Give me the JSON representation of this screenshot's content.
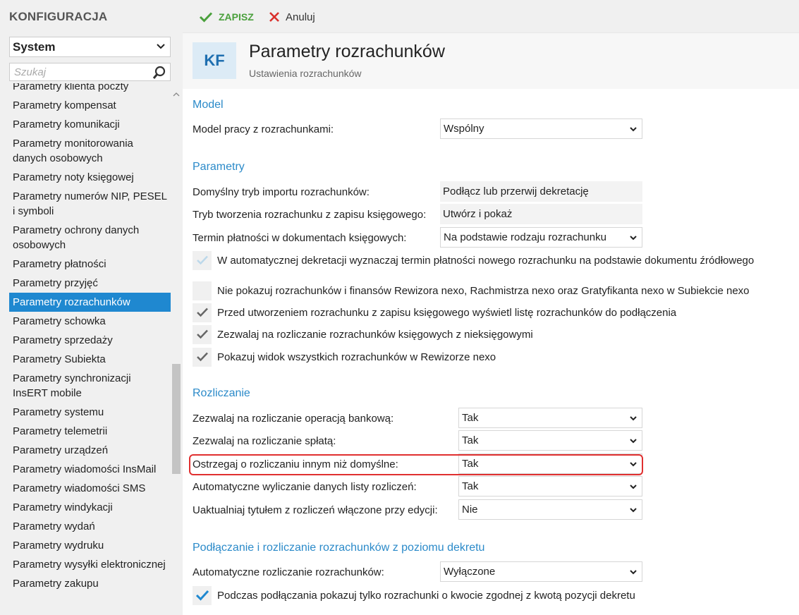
{
  "app": {
    "title": "KONFIGURACJA"
  },
  "toolbar": {
    "save_label": "ZAPISZ",
    "cancel_label": "Anuluj"
  },
  "sidebar": {
    "module": "System",
    "search_placeholder": "Szukaj",
    "items": [
      "Parametry klienta poczty",
      "Parametry kompensat",
      "Parametry komunikacji",
      "Parametry monitorowania danych osobowych",
      "Parametry noty księgowej",
      "Parametry numerów NIP, PESEL i symboli",
      "Parametry ochrony danych osobowych",
      "Parametry płatności",
      "Parametry przyjęć",
      "Parametry rozrachunków",
      "Parametry schowka",
      "Parametry sprzedaży",
      "Parametry Subiekta",
      "Parametry synchronizacji InsERT mobile",
      "Parametry systemu",
      "Parametry telemetrii",
      "Parametry urządzeń",
      "Parametry wiadomości InsMail",
      "Parametry wiadomości SMS",
      "Parametry windykacji",
      "Parametry wydań",
      "Parametry wydruku",
      "Parametry wysyłki elektronicznej",
      "Parametry zakupu"
    ],
    "active_index": 9
  },
  "header": {
    "badge": "KF",
    "title": "Parametry rozrachunków",
    "subtitle": "Ustawienia rozrachunków"
  },
  "model": {
    "section": "Model",
    "label": "Model pracy z rozrachunkami:",
    "value": "Wspólny"
  },
  "parametry": {
    "section": "Parametry",
    "import_label": "Domyślny tryb importu rozrachunków:",
    "import_value": "Podłącz lub przerwij dekretację",
    "create_label": "Tryb tworzenia rozrachunku z zapisu księgowego:",
    "create_value": "Utwórz i pokaż",
    "term_label": "Termin płatności w dokumentach księgowych:",
    "term_value": "Na podstawie rodzaju rozrachunku",
    "checkboxes": [
      {
        "label": "W automatycznej dekretacji wyznaczaj termin płatności nowego rozrachunku na podstawie dokumentu źródłowego",
        "state": "disabled-checked"
      },
      {
        "label": "Nie pokazuj rozrachunków i finansów Rewizora nexo, Rachmistrza nexo oraz Gratyfikanta nexo w Subiekcie nexo",
        "state": "unchecked"
      },
      {
        "label": "Przed utworzeniem rozrachunku z zapisu księgowego wyświetl listę rozrachunków do podłączenia",
        "state": "checked-grey"
      },
      {
        "label": "Zezwalaj na rozliczanie rozrachunków księgowych z nieksięgowymi",
        "state": "checked-grey"
      },
      {
        "label": "Pokazuj widok wszystkich rozrachunków w Rewizorze nexo",
        "state": "checked-grey"
      }
    ]
  },
  "rozliczanie": {
    "section": "Rozliczanie",
    "rows": [
      {
        "label": "Zezwalaj na rozliczanie operacją bankową:",
        "value": "Tak"
      },
      {
        "label": "Zezwalaj na rozliczanie spłatą:",
        "value": "Tak"
      },
      {
        "label": "Ostrzegaj o rozliczaniu innym niż domyślne:",
        "value": "Tak"
      },
      {
        "label": "Automatyczne wyliczanie danych listy rozliczeń:",
        "value": "Tak"
      },
      {
        "label": "Uaktualniaj tytułem z rozliczeń włączone przy edycji:",
        "value": "Nie"
      }
    ]
  },
  "dekret": {
    "section": "Podłączanie i rozliczanie rozrachunków z poziomu dekretu",
    "label": "Automatyczne rozliczanie rozrachunków:",
    "value": "Wyłączone",
    "checkbox_label": "Podczas podłączania pokazuj tylko rozrachunki o kwocie zgodnej z kwotą pozycji dekretu",
    "checkbox_state": "checked-blue"
  },
  "colors": {
    "accent": "#1f88d0",
    "save_green": "#4aa03c",
    "cancel_red": "#d9302c",
    "section_blue": "#2b8ac9",
    "highlight_red": "#e03030"
  }
}
